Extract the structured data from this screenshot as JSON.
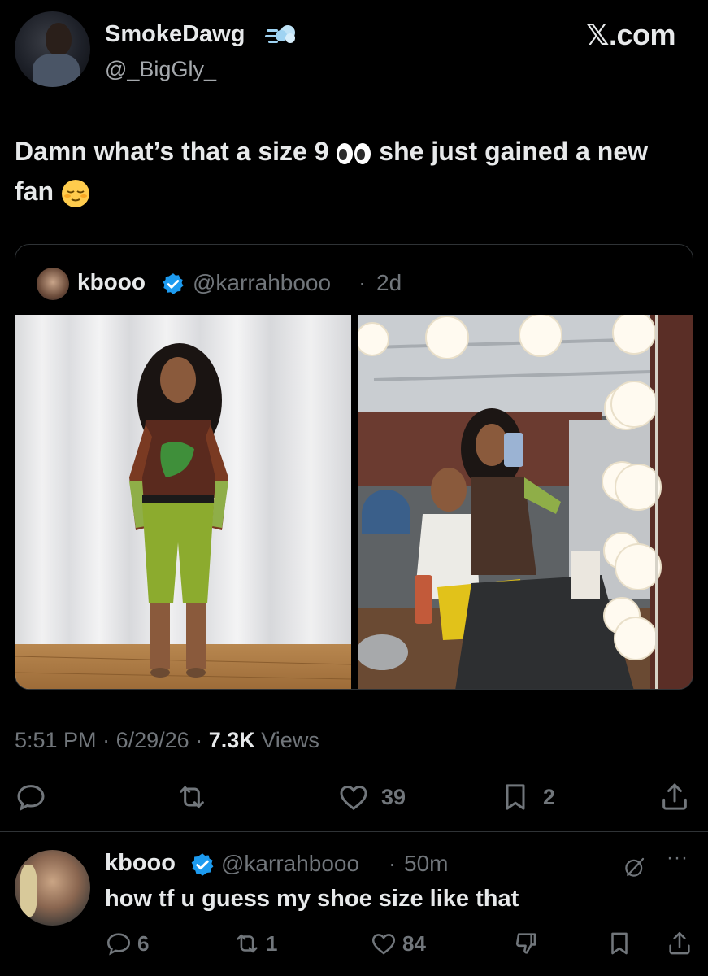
{
  "header": {
    "author_name": "SmokeDawg",
    "author_handle": "@_BigGly_",
    "site_logo": "𝕏.com",
    "name_emoji_icon": "dash-away-icon"
  },
  "tweet": {
    "text_part1": "Damn what’s that a size 9",
    "eyes_emoji_icon": "eyes-emoji-icon",
    "text_part2": "she just gained a new fan",
    "relieved_emoji_icon": "relieved-face-emoji-icon"
  },
  "quote": {
    "name": "kbooo",
    "handle": "@karrahbooo",
    "dot": "·",
    "time": "2d"
  },
  "meta": {
    "time": "5:51 PM",
    "sep1": "·",
    "date": "6/29/26",
    "sep2": "·",
    "views_count": "7.3K",
    "views_label": "Views"
  },
  "actions": {
    "reply_count": "",
    "retweet_count": "",
    "like_count": "39",
    "bookmark_count": "2"
  },
  "reply": {
    "name": "kbooo",
    "handle": "@karrahbooo",
    "dot": "·",
    "time": "50m",
    "text": "how tf u guess my shoe size like that",
    "reply_count": "6",
    "retweet_count": "1",
    "like_count": "84",
    "more_label": "···"
  },
  "colors": {
    "background": "#000000",
    "text_primary": "#e7e9ea",
    "text_secondary": "#71767b",
    "verified_blue": "#1d9bf0",
    "border": "#2f3336"
  }
}
